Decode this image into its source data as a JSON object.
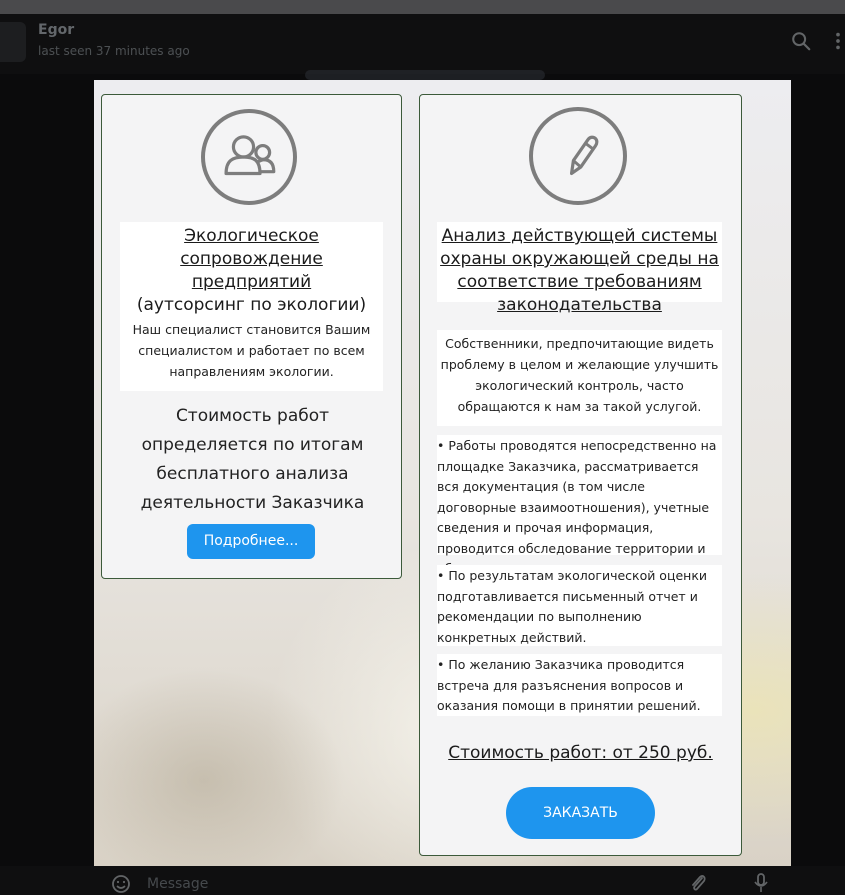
{
  "chat": {
    "contact_name": "Egor",
    "status": "last seen 37 minutes ago",
    "message_placeholder": "Message"
  },
  "left_card": {
    "icon": "users-icon",
    "title_underlined": "Экологическое сопровождение предприятий",
    "subtitle": "(аутсорсинг по экологии)",
    "description": "Наш специалист становится Вашим специалистом и работает по всем направлениям экологии.",
    "cost_text": "Стоимость работ определяется по итогам бесплатного анализа деятельности Заказчика",
    "button_label": "Подробнее..."
  },
  "right_card": {
    "icon": "pencil-icon",
    "title_underlined": "Анализ действующей системы охраны окружающей среды на соответствие требованиям законодательства",
    "description": "Собственники, предпочитающие видеть проблему в целом и желающие улучшить экологический контроль, часто обращаются к нам за такой услугой.",
    "bullets": [
      "• Работы проводятся непосредственно на площадке Заказчика, рассматривается вся документация (в том числе договорные взаимоотношения), учетные сведения и прочая информация, проводится обследование территории и объектов.",
      "• По результатам экологической оценки подготавливается письменный отчет и рекомендации по выполнению конкретных действий.",
      "• По желанию Заказчика проводится встреча для разъяснения вопросов и оказания помощи в принятии решений."
    ],
    "cost_text": "Стоимость работ: от 250 руб.",
    "button_label": "ЗАКАЗАТЬ"
  },
  "colors": {
    "accent_button": "#1e95ee",
    "card_border": "#3c5a3a",
    "icon_stroke": "#7d7d7d"
  }
}
